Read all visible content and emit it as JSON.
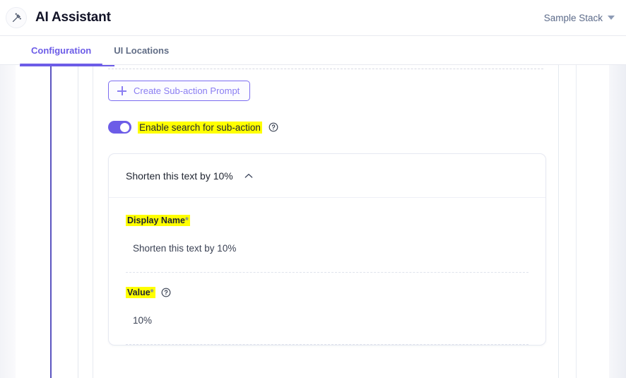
{
  "header": {
    "app_icon": "magic-wand-icon",
    "title": "AI Assistant",
    "stack_selector": {
      "label": "Sample Stack",
      "icon": "chevron-down-icon"
    }
  },
  "tabs": [
    {
      "label": "Configuration",
      "active": true
    },
    {
      "label": "UI Locations",
      "active": false
    }
  ],
  "content": {
    "create_button": {
      "label": "Create Sub-action Prompt",
      "icon": "plus-icon"
    },
    "search_toggle": {
      "label": "Enable search for sub-action",
      "state": "on",
      "help_icon": "question-mark-circle-icon",
      "highlighted": true
    },
    "card": {
      "title": "Shorten this text by 10%",
      "collapse_icon": "chevron-up-icon",
      "fields": [
        {
          "label": "Display Name",
          "required_marker": "*",
          "value": "Shorten this text by 10%",
          "help_icon": null,
          "highlighted": true
        },
        {
          "label": "Value",
          "required_marker": "*",
          "value": "10%",
          "help_icon": "question-mark-circle-icon",
          "highlighted": true
        }
      ]
    }
  },
  "colors": {
    "accent": "#6c5ce7",
    "accent_light": "#8a7df2",
    "rail": "#5b55c0",
    "highlight": "#ffff00",
    "text": "#1f2430",
    "muted": "#5c6b8a",
    "canvas": "#f3f4f8"
  }
}
